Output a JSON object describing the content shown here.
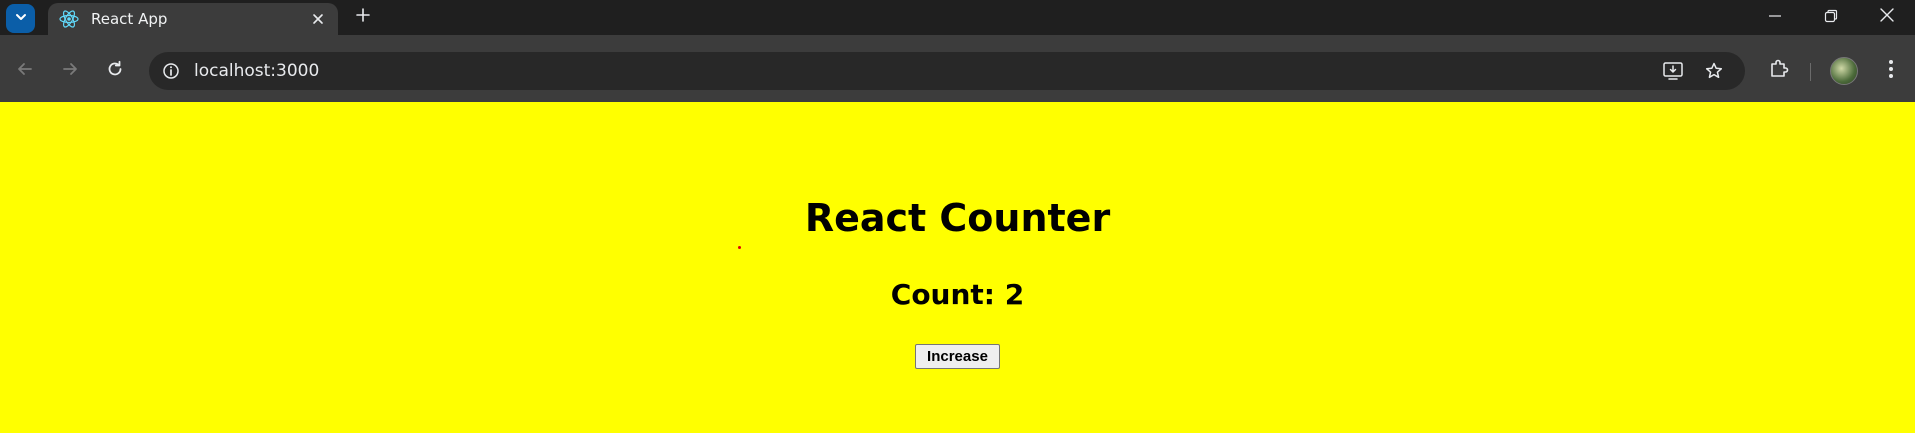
{
  "browser": {
    "tab": {
      "title": "React App",
      "favicon": "react-atom-icon"
    },
    "address_bar": {
      "url": "localhost:3000"
    },
    "colors": {
      "tabbar_bg": "#1f1f1f",
      "toolbar_bg": "#3c3c3c",
      "omnibox_bg": "#282828",
      "tab_search_accent": "#0b5ea8",
      "react_blue": "#61dafb"
    }
  },
  "page": {
    "background": "#ffff00",
    "title": "React Counter",
    "count_label": "Count: 2",
    "button_label": "Increase"
  }
}
